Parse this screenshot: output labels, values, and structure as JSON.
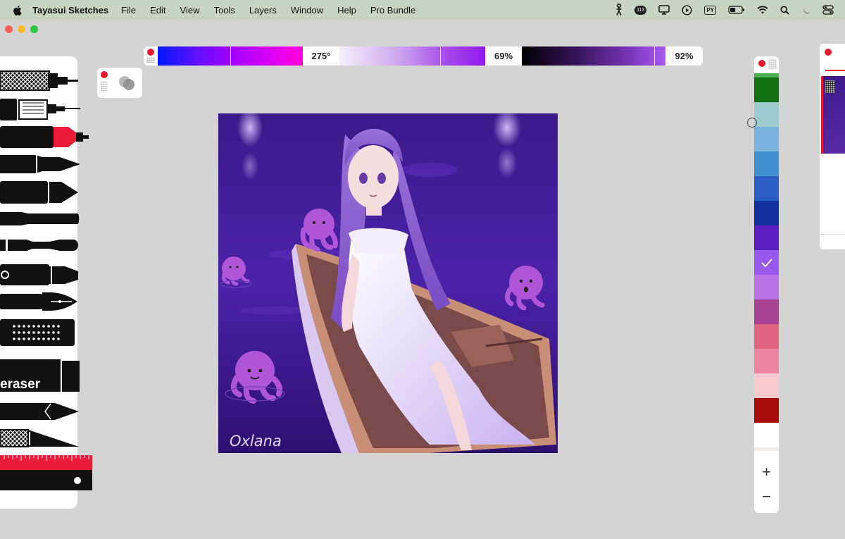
{
  "menubar": {
    "app_name": "Tayasui Sketches",
    "items": [
      "File",
      "Edit",
      "View",
      "Tools",
      "Layers",
      "Window",
      "Help",
      "Pro Bundle"
    ],
    "status_icons": [
      "puppet-icon",
      "badge-113-icon",
      "display-icon",
      "play-icon",
      "py-icon",
      "battery-icon",
      "wifi-icon",
      "search-icon",
      "moon-icon",
      "control-center-icon"
    ],
    "badge_text": "113",
    "py_text": "PY"
  },
  "color_bar": {
    "hue_label": "275°",
    "saturation_label": "69%",
    "brightness_label": "92%",
    "hue": 275,
    "saturation": 0.69,
    "brightness": 0.92
  },
  "tools": {
    "eraser_label": "eraser",
    "items": [
      "mechanical-pencil",
      "technical-pen",
      "red-felt-pen",
      "fineliner",
      "marker",
      "brush",
      "watercolor-brush",
      "airbrush",
      "fountain-pen",
      "pattern-stamp",
      "eraser",
      "pencil",
      "cutter",
      "ruler"
    ]
  },
  "canvas": {
    "signature": "Oxlana"
  },
  "palette": {
    "colors": [
      "#117111",
      "#9ccccd",
      "#79b3dd",
      "#3f8fd1",
      "#2a5ec3",
      "#1332a0",
      "#5c20bf",
      "#9a59ee",
      "#b873e6",
      "#a84394",
      "#e0677f",
      "#ec86a2",
      "#f9c9d0",
      "#a80c0a",
      "#ffffff"
    ],
    "selected_index": 7,
    "plus_label": "+",
    "minus_label": "−"
  },
  "colors": {
    "menubar_bg": "#c9d5c3",
    "workspace_bg": "#d4d4d4",
    "accent_red": "#e8192c"
  }
}
